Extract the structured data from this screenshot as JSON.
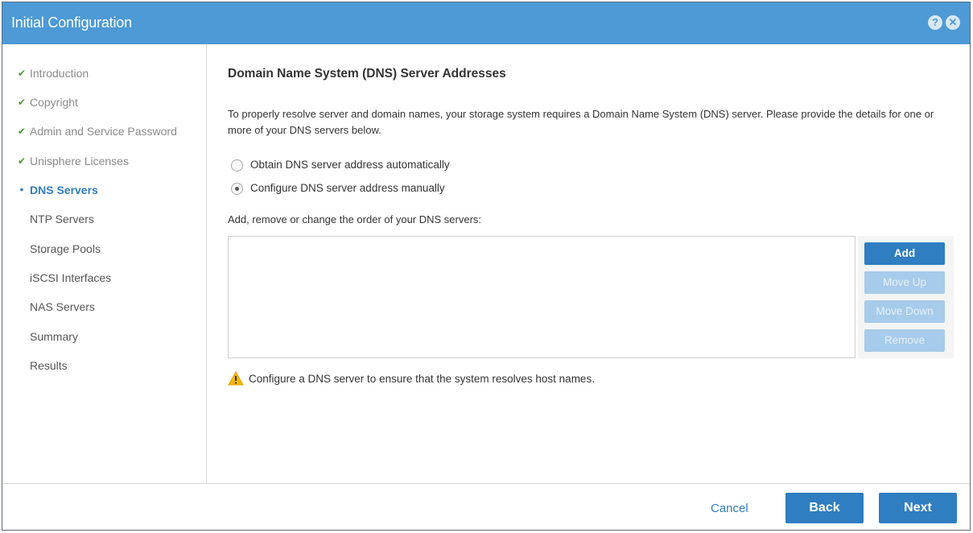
{
  "window": {
    "title": "Initial Configuration",
    "help_icon": "question-icon",
    "close_icon": "close-icon"
  },
  "sidebar": {
    "items": [
      {
        "label": "Introduction",
        "state": "done"
      },
      {
        "label": "Copyright",
        "state": "done"
      },
      {
        "label": "Admin and Service Password",
        "state": "done"
      },
      {
        "label": "Unisphere Licenses",
        "state": "done"
      },
      {
        "label": "DNS Servers",
        "state": "current"
      },
      {
        "label": "NTP Servers",
        "state": "pending"
      },
      {
        "label": "Storage Pools",
        "state": "pending"
      },
      {
        "label": "iSCSI Interfaces",
        "state": "pending"
      },
      {
        "label": "NAS Servers",
        "state": "pending"
      },
      {
        "label": "Summary",
        "state": "pending"
      },
      {
        "label": "Results",
        "state": "pending"
      }
    ]
  },
  "main": {
    "heading": "Domain Name System (DNS) Server Addresses",
    "description": "To properly resolve server and domain names, your storage system requires a Domain Name System (DNS) server. Please provide the details for one or more of your DNS servers below.",
    "options": [
      {
        "label": "Obtain DNS server address automatically",
        "selected": false
      },
      {
        "label": "Configure DNS server address manually",
        "selected": true
      }
    ],
    "list_label": "Add, remove or change the order of your DNS servers:",
    "dns_servers": [],
    "buttons": {
      "add": "Add",
      "move_up": "Move Up",
      "move_down": "Move Down",
      "remove": "Remove"
    },
    "warning": "Configure a DNS server to ensure that the system resolves host names."
  },
  "footer": {
    "cancel": "Cancel",
    "back": "Back",
    "next": "Next"
  },
  "colors": {
    "titlebar": "#4d9ad6",
    "primary": "#2f7ec1",
    "disabled": "#a7cbea",
    "check": "#4a9a2c",
    "warning": "#f5b800"
  }
}
